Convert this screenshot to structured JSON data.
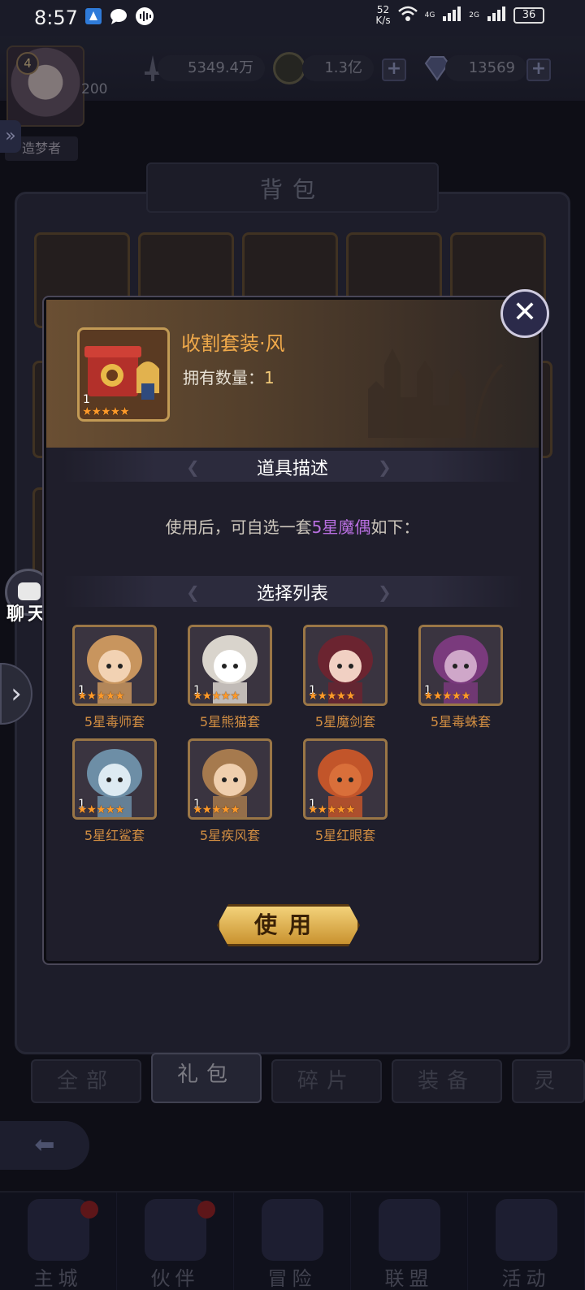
{
  "status_bar": {
    "time": "8:57",
    "speed_top": "52",
    "speed_bottom": "K/s",
    "net1": "4G",
    "net2": "2G",
    "battery": "36"
  },
  "resources": {
    "power": "5349.4万",
    "gold": "1.3亿",
    "diamonds": "13569",
    "add_symbol": "+"
  },
  "player": {
    "level": "4",
    "exp_partial": "200",
    "name_partial": "造梦者"
  },
  "bag": {
    "title": "背包",
    "tabs": [
      "全部",
      "礼包",
      "碎片",
      "装备",
      "灵"
    ],
    "active_tab_index": 1
  },
  "chat": {
    "label": "聊天"
  },
  "modal": {
    "item_name": "收割套装·风",
    "count_label": "拥有数量：",
    "count_value": "1",
    "item_qty": "1",
    "item_stars": 5,
    "description_title": "道具描述",
    "description_prefix": "使用后，可自选一套",
    "description_highlight": "5星魔偶",
    "description_suffix": "如下：",
    "choice_title": "选择列表",
    "use_button": "使用",
    "choices": [
      {
        "label": "5星毒师套",
        "qty": "1",
        "stars": 5,
        "color": "#c8955e"
      },
      {
        "label": "5星熊猫套",
        "qty": "1",
        "stars": 5,
        "color": "#d9d4cc"
      },
      {
        "label": "5星魔剑套",
        "qty": "1",
        "stars": 5,
        "color": "#6b2430"
      },
      {
        "label": "5星毒蛛套",
        "qty": "1",
        "stars": 5,
        "color": "#7a3a7d"
      },
      {
        "label": "5星红鲨套",
        "qty": "1",
        "stars": 5,
        "color": "#6d8ea6"
      },
      {
        "label": "5星疾风套",
        "qty": "1",
        "stars": 5,
        "color": "#a67a4e"
      },
      {
        "label": "5星红眼套",
        "qty": "1",
        "stars": 5,
        "color": "#c2552a"
      }
    ]
  },
  "nav": [
    {
      "label": "主城",
      "icon": "castle-icon",
      "badge": true
    },
    {
      "label": "伙伴",
      "icon": "hat-icon",
      "badge": true
    },
    {
      "label": "冒险",
      "icon": "compass-icon",
      "badge": false
    },
    {
      "label": "联盟",
      "icon": "shield-icon",
      "badge": false
    },
    {
      "label": "活动",
      "icon": "cards-icon",
      "badge": false
    }
  ],
  "colors": {
    "accent_gold": "#f0a94a",
    "highlight_purple": "#b86fe0",
    "star_orange": "#ff9a2a"
  }
}
